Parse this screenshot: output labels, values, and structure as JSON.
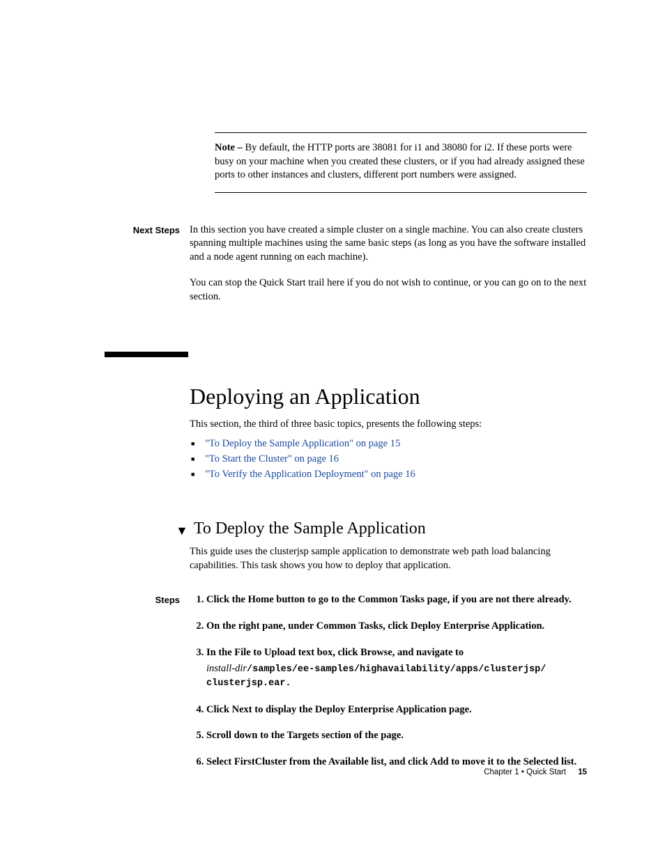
{
  "note": {
    "label": "Note –",
    "text": " By default, the HTTP ports are 38081 for i1 and 38080 for i2. If these ports were busy on your machine when you created these clusters, or if you had already assigned these ports to other instances and clusters, different port numbers were assigned."
  },
  "next_steps": {
    "label": "Next Steps",
    "para1": "In this section you have created a simple cluster on a single machine. You can also create clusters spanning multiple machines using the same basic steps (as long as you have the software installed and a node agent running on each machine).",
    "para2": "You can stop the Quick Start trail here if you do not wish to continue, or you can go on to the next section."
  },
  "section": {
    "title": "Deploying an Application",
    "intro": "This section, the third of three basic topics, presents the following steps:",
    "toc": [
      "\"To Deploy the Sample Application\" on page 15",
      "\"To Start the Cluster\" on page 16",
      "\"To Verify the Application Deployment\" on page 16"
    ]
  },
  "subsection": {
    "title": "To Deploy the Sample Application",
    "intro": "This guide uses the clusterjsp sample application to demonstrate web path load balancing capabilities. This task shows you how to deploy that application."
  },
  "steps": {
    "label": "Steps",
    "items": [
      "Click the Home button to go to the Common Tasks page, if you are not there already.",
      "On the right pane, under Common Tasks, click Deploy Enterprise Application.",
      "In the File to Upload text box, click Browse, and navigate to",
      "Click Next to display the Deploy Enterprise Application page.",
      "Scroll down to the Targets section of the page.",
      "Select FirstCluster from the Available list, and click Add to move it to the Selected list."
    ],
    "step3_path_italic": "install-dir",
    "step3_path_mono": "/samples/ee-samples/highavailability/apps/clusterjsp/ clusterjsp.ear",
    "step3_path_end": "."
  },
  "footer": {
    "chapter": "Chapter 1 • Quick Start",
    "page": "15"
  }
}
